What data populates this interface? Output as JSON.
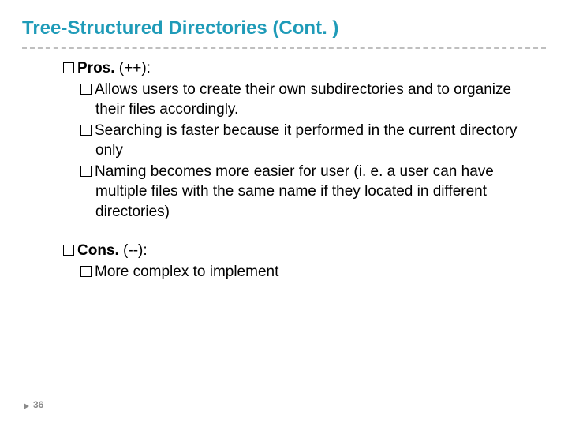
{
  "title": "Tree-Structured Directories (Cont. )",
  "pros": {
    "label": "Pros.",
    "suffix": " (++):",
    "items": [
      "Allows users to create their own subdirectories and to organize their files accordingly.",
      "Searching is faster because it performed in the current directory only",
      "Naming becomes more easier for user (i. e. a user can have multiple files with the same name if they located in different directories)"
    ]
  },
  "cons": {
    "label": "Cons.",
    "suffix": " (--):",
    "items": [
      "More complex to implement"
    ]
  },
  "page_number": "36"
}
